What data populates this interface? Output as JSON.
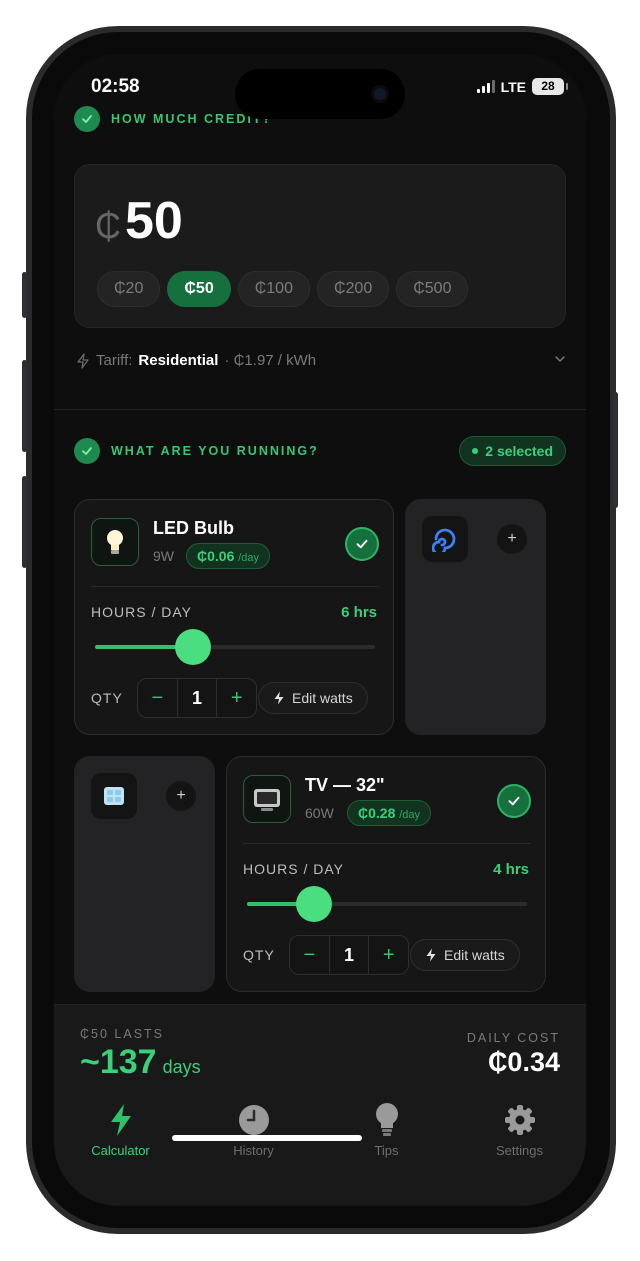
{
  "status": {
    "time": "02:58",
    "network": "LTE",
    "battery": "28"
  },
  "credit": {
    "section_label": "HOW MUCH CREDIT?",
    "currency_symbol": "₵",
    "amount": "50",
    "presets": [
      "₵20",
      "₵50",
      "₵100",
      "₵200",
      "₵500"
    ],
    "selected_preset": "₵50"
  },
  "tariff": {
    "label": "Tariff:",
    "value": "Residential",
    "rate": "· ₵1.97 / kWh"
  },
  "appliances": {
    "section_label": "WHAT ARE YOU RUNNING?",
    "selected_badge": "2 selected",
    "items": [
      {
        "name": "LED Bulb",
        "watts": "9W",
        "cost": "₵0.06",
        "cost_unit": "/day",
        "hours_label": "HOURS / DAY",
        "hours_value": "6 hrs",
        "hours_fraction": 0.35,
        "qty_label": "QTY",
        "qty": "1",
        "edit_label": "Edit watts",
        "selected": true,
        "icon": "lightbulb-icon"
      },
      {
        "icon": "fan-icon",
        "selected": false
      },
      {
        "icon": "ice-icon",
        "selected": false
      },
      {
        "name": "TV — 32\"",
        "watts": "60W",
        "cost": "₵0.28",
        "cost_unit": "/day",
        "hours_label": "HOURS / DAY",
        "hours_value": "4 hrs",
        "hours_fraction": 0.24,
        "qty_label": "QTY",
        "qty": "1",
        "edit_label": "Edit watts",
        "selected": true,
        "icon": "tv-icon"
      }
    ]
  },
  "summary": {
    "lasts_label": "₵50 LASTS",
    "lasts_value": "~137",
    "lasts_unit": "days",
    "daily_label": "DAILY COST",
    "daily_value": "₵0.34"
  },
  "tabs": [
    {
      "label": "Calculator",
      "icon": "bolt-icon",
      "active": true
    },
    {
      "label": "History",
      "icon": "clock-icon",
      "active": false
    },
    {
      "label": "Tips",
      "icon": "lightbulb-icon",
      "active": false
    },
    {
      "label": "Settings",
      "icon": "gear-icon",
      "active": false
    }
  ],
  "colors": {
    "accent": "#3ad17a",
    "accent_dark": "#16703d",
    "background": "#0e0e0f",
    "card": "#1b1b1c"
  }
}
